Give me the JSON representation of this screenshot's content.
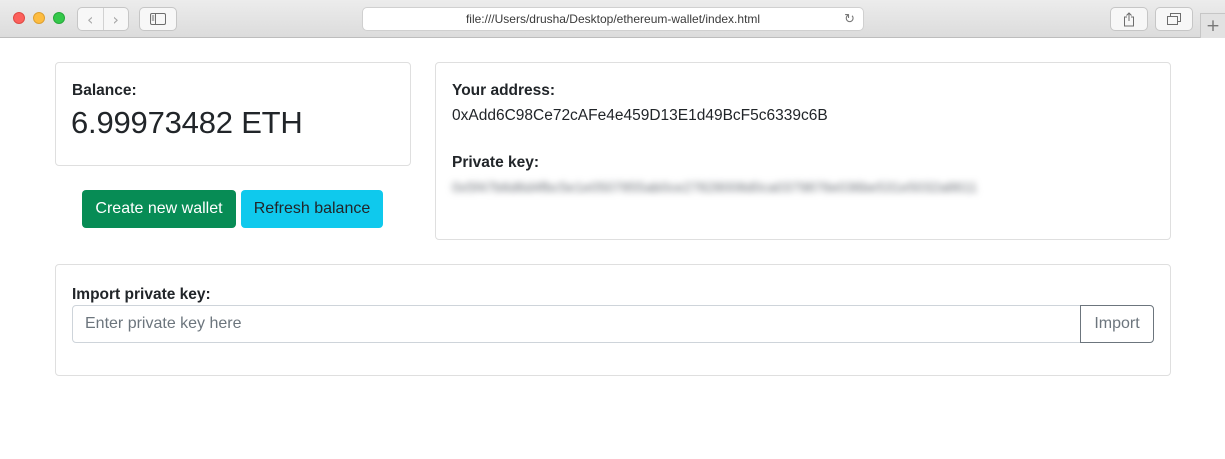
{
  "browser": {
    "url": "file:///Users/drusha/Desktop/ethereum-wallet/index.html",
    "icons": {
      "back": "chevron-left-icon",
      "forward": "chevron-right-icon",
      "sidebar": "sidebar-icon",
      "reload": "reload-icon",
      "share": "share-icon",
      "tabs": "tabs-overview-icon",
      "new_tab": "plus-icon"
    },
    "glyphs": {
      "back": "‹",
      "forward": "›",
      "reload": "↻",
      "new_tab": "+"
    }
  },
  "balance": {
    "label": "Balance:",
    "value": "6.99973482 ETH"
  },
  "wallet": {
    "address_label": "Your address:",
    "address": "0xAdd6C98Ce72cAFe4e459D13E1d49BcF5c6339c6B",
    "private_key_label": "Private key:",
    "private_key": "0x5f47b6d6d4fbc5e1e0507855ab0ce27828008d0ca0379876e036be531e5032a8611"
  },
  "actions": {
    "create_label": "Create new wallet",
    "refresh_label": "Refresh balance"
  },
  "import": {
    "label": "Import private key:",
    "placeholder": "Enter private key here",
    "button_label": "Import"
  },
  "colors": {
    "create_button": "#078c55",
    "refresh_button": "#0fc9ed",
    "import_button_border": "#6c757d"
  }
}
